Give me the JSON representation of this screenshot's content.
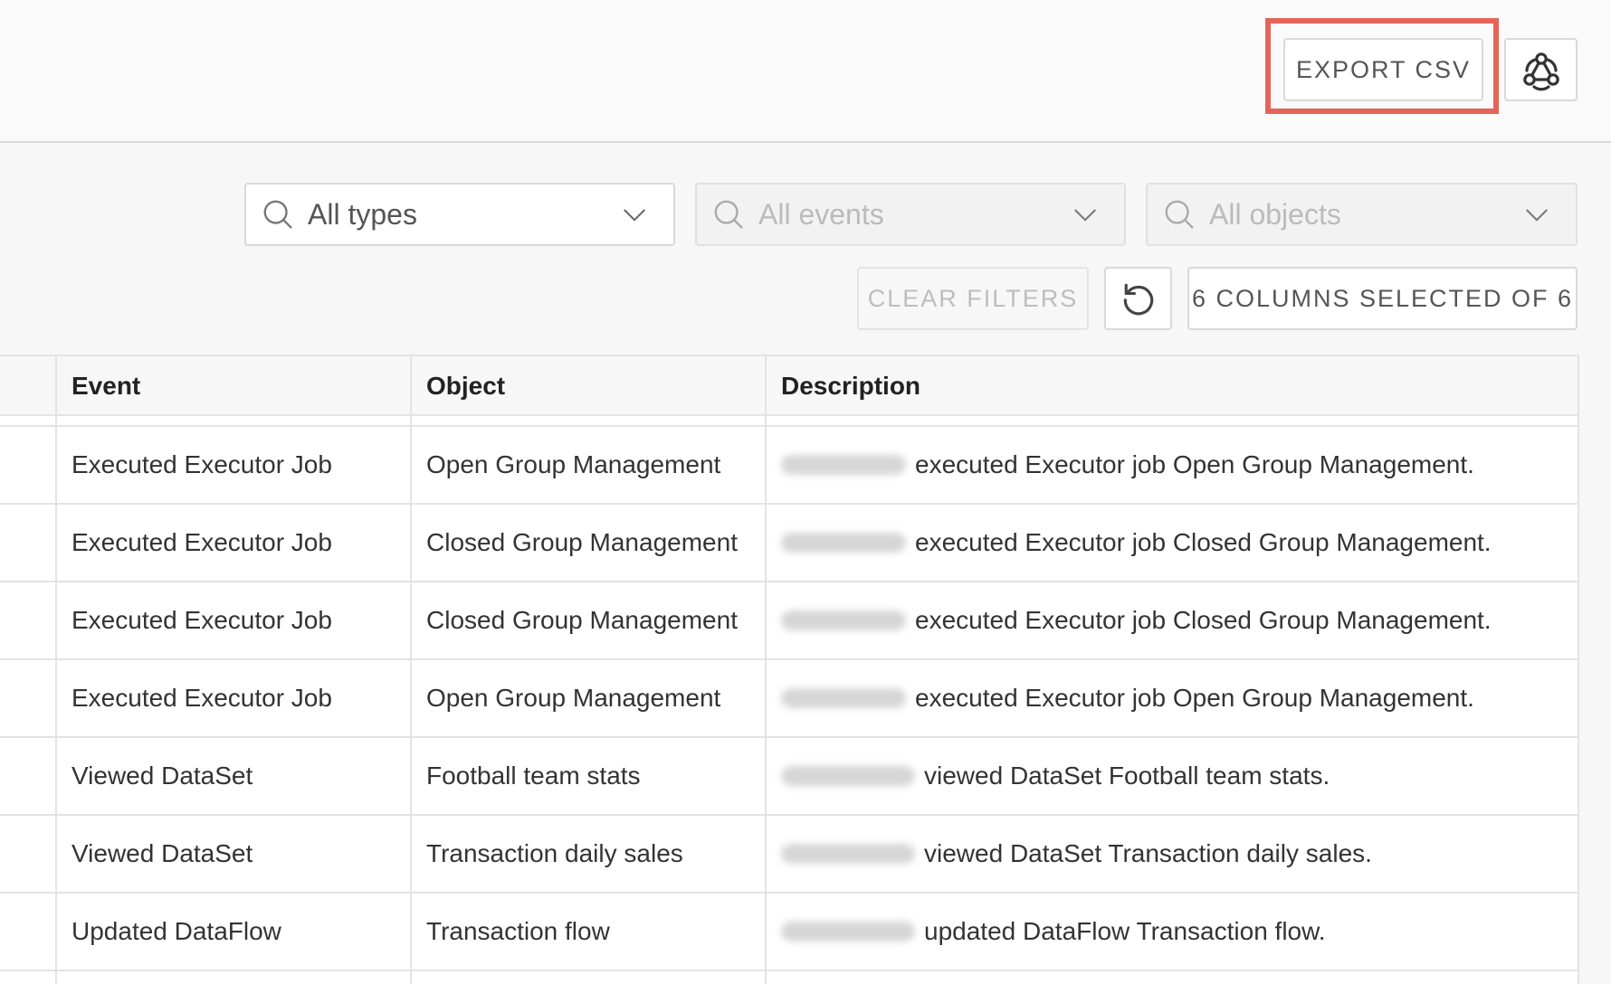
{
  "header": {
    "export_label": "EXPORT CSV",
    "webhook_icon": "webhook-icon"
  },
  "filters": {
    "types_placeholder": "All types",
    "events_placeholder": "All events",
    "objects_placeholder": "All objects",
    "clear_label": "CLEAR FILTERS",
    "reset_icon": "reset-icon",
    "columns_label": "6 COLUMNS SELECTED OF 6"
  },
  "table": {
    "columns": [
      "Event",
      "Object",
      "Description"
    ],
    "rows": [
      {
        "event": "Executed Executor Job",
        "object": "Open Group Management",
        "description": "executed Executor job Open Group Management."
      },
      {
        "event": "Executed Executor Job",
        "object": "Closed Group Management",
        "description": "executed Executor job Closed Group Management."
      },
      {
        "event": "Executed Executor Job",
        "object": "Closed Group Management",
        "description": "executed Executor job Closed Group Management."
      },
      {
        "event": "Executed Executor Job",
        "object": "Open Group Management",
        "description": "executed Executor job Open Group Management."
      },
      {
        "event": "Viewed DataSet",
        "object": "Football team stats",
        "description": "viewed DataSet Football team stats."
      },
      {
        "event": "Viewed DataSet",
        "object": "Transaction daily sales",
        "description": "viewed DataSet Transaction daily sales."
      },
      {
        "event": "Updated DataFlow",
        "object": "Transaction flow",
        "description": "updated DataFlow Transaction flow."
      }
    ]
  },
  "colors": {
    "highlight": "#e5645a",
    "border": "#d9d9d9"
  }
}
